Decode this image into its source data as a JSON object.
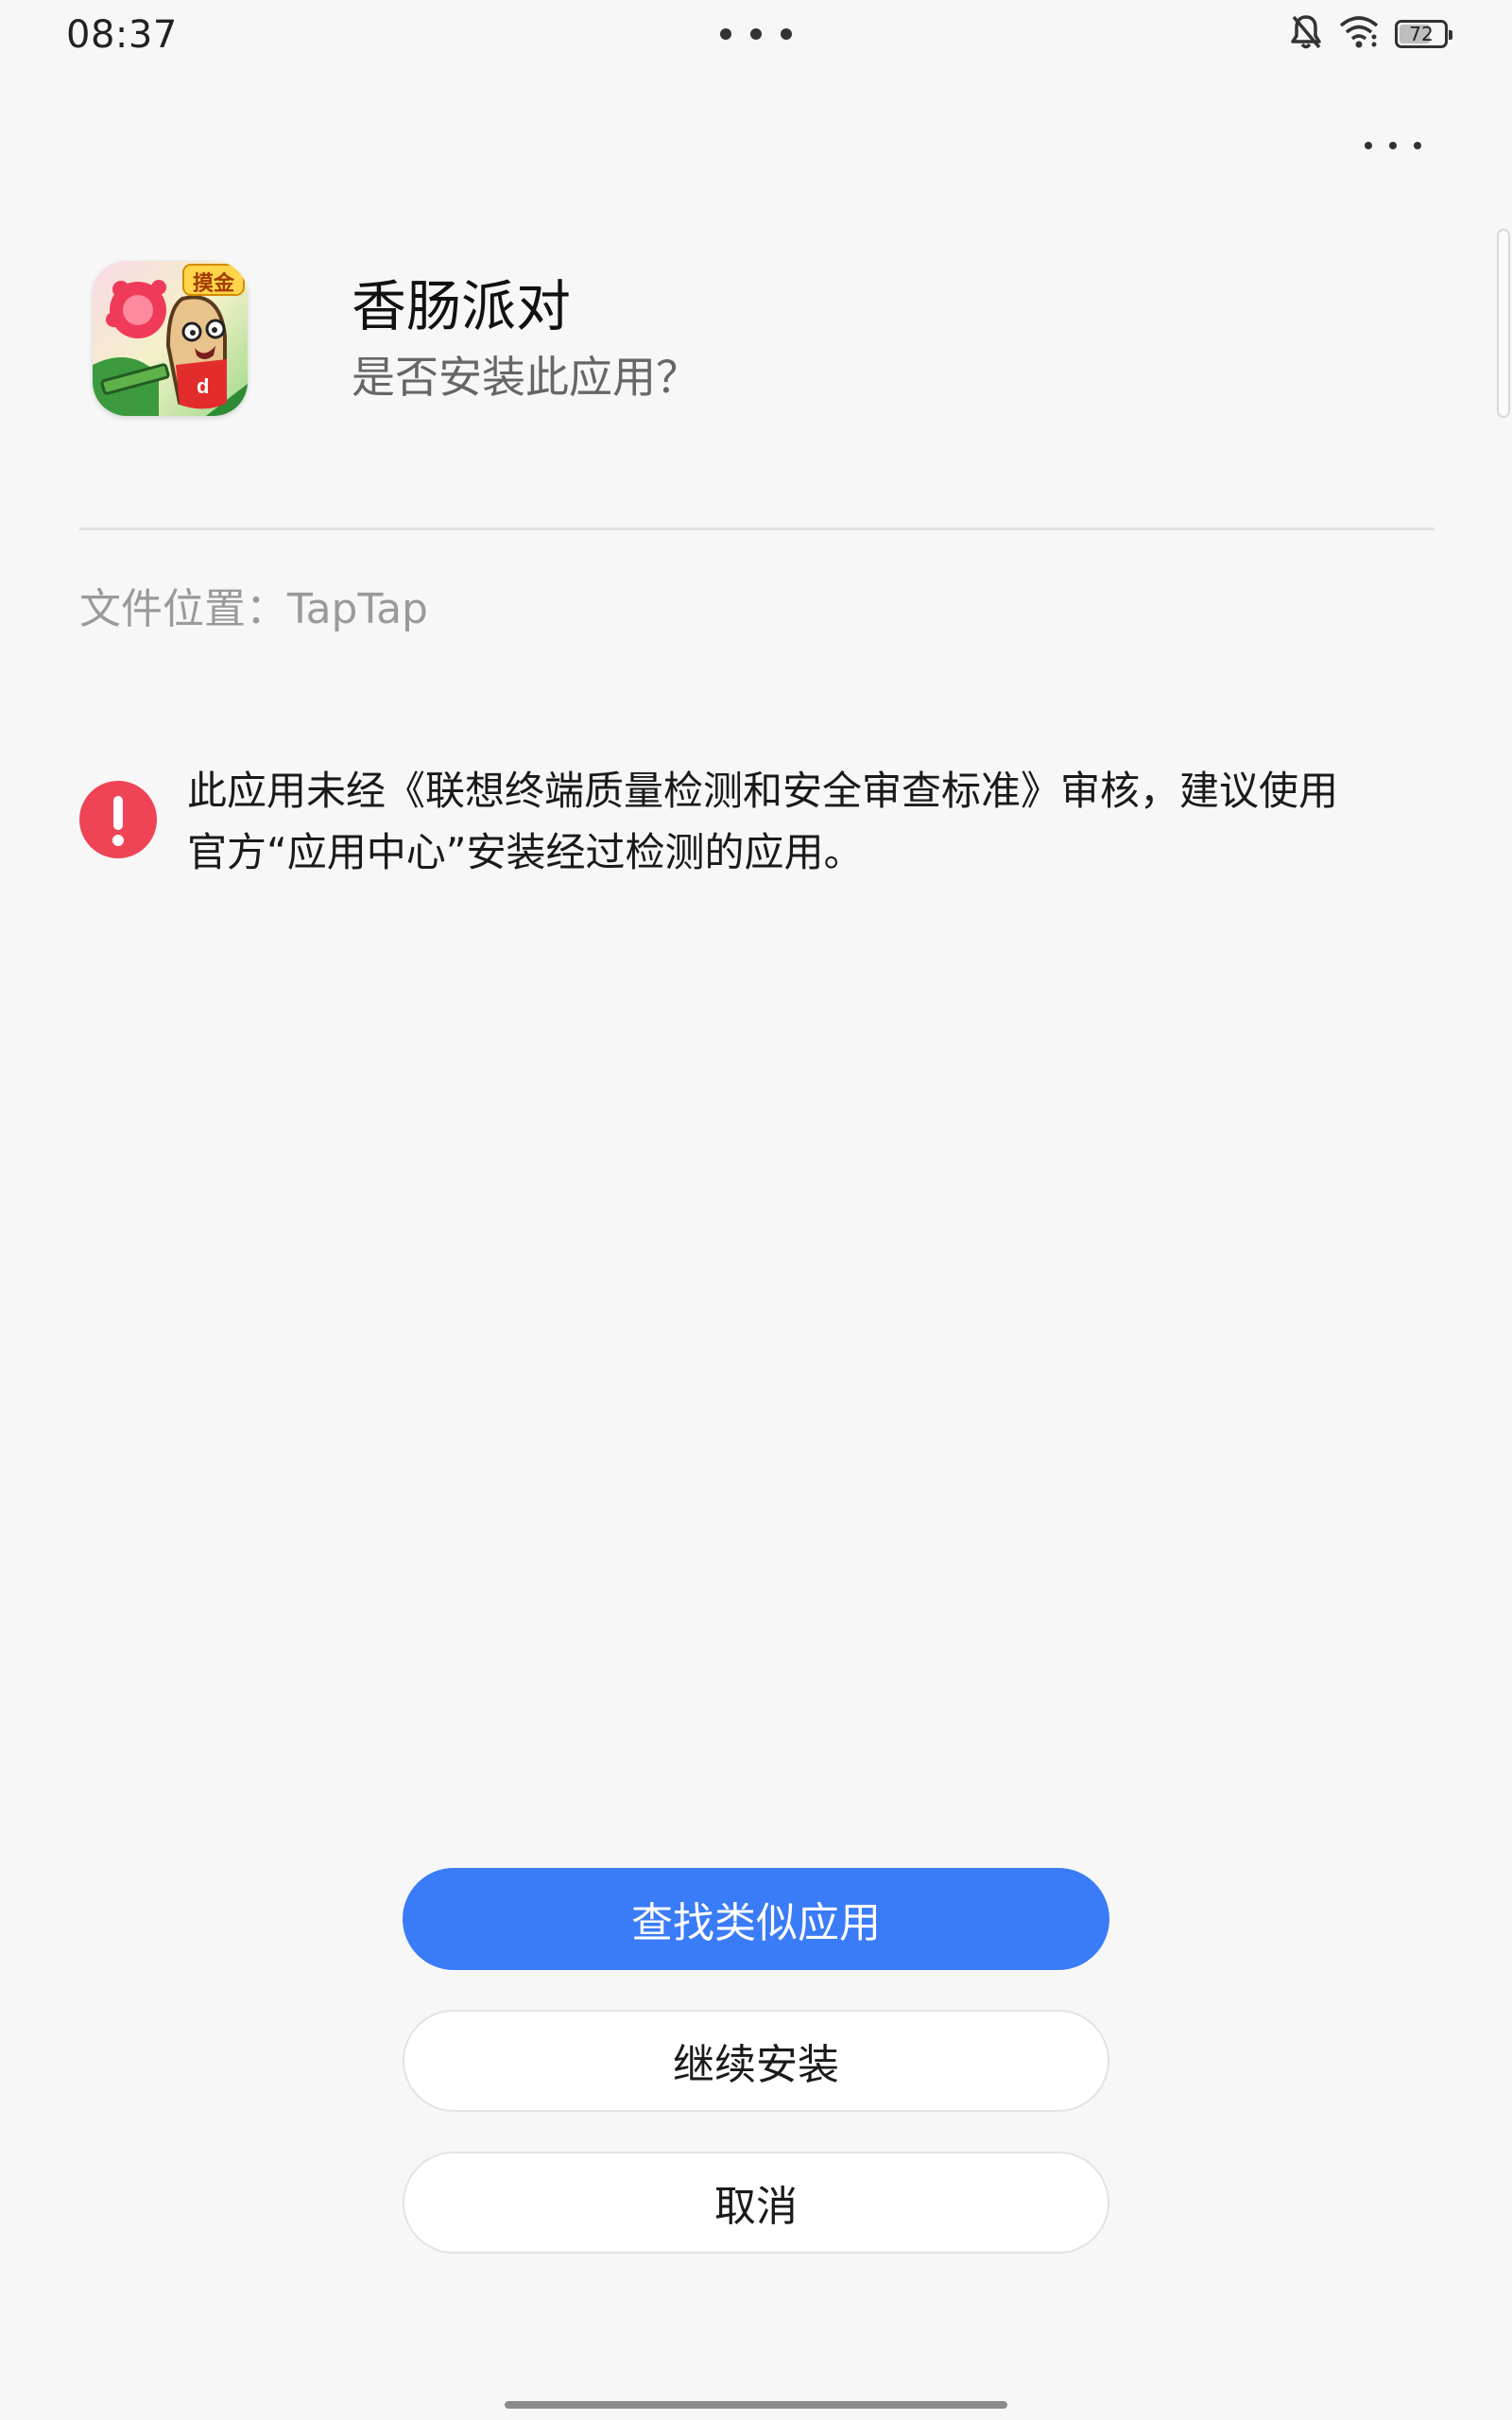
{
  "status_bar": {
    "time": "08:37",
    "battery_level": "72",
    "battery_fraction": 0.72,
    "icons": [
      "notifications-off-icon",
      "wifi-icon",
      "battery-icon"
    ]
  },
  "header": {
    "more_icon": "more-horizontal-icon"
  },
  "app": {
    "name": "香肠派对",
    "question": "是否安装此应用？",
    "icon_badge": "摸金"
  },
  "file_location": "文件位置：TapTap",
  "warning": {
    "icon": "exclamation-icon",
    "line1": "此应用未经《联想终端质量检测和安全审查标准》审核，建议使用",
    "line2": "官方“应用中心”安装经过检测的应用。",
    "color": "#ee4455"
  },
  "buttons": {
    "find_similar": "查找类似应用",
    "continue_install": "继续安装",
    "cancel": "取消"
  },
  "colors": {
    "accent": "#3a7bf7",
    "background": "#f7f7f7"
  }
}
